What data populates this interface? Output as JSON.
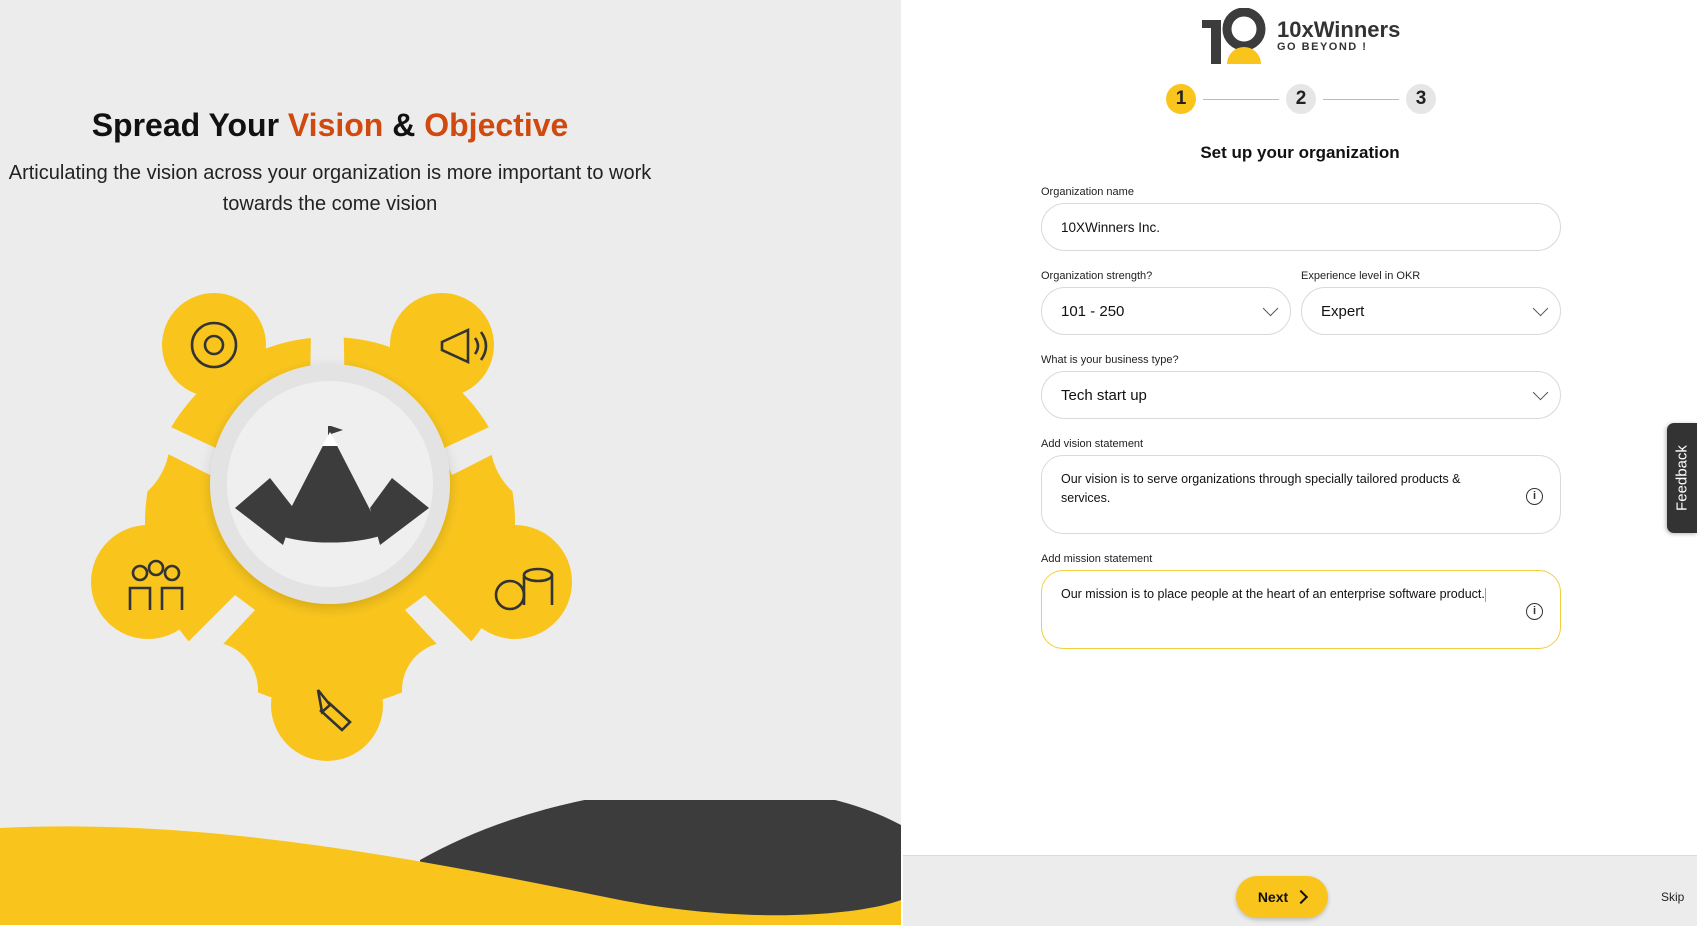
{
  "hero": {
    "title_part1": "Spread Your ",
    "title_accent1": "Vision",
    "title_part2": " & ",
    "title_accent2": "Objective",
    "subtitle": "Articulating the vision across your organization is more important to work towards the come vision"
  },
  "brand": {
    "name": "10xWinners",
    "tagline": "GO BEYOND !",
    "accent_color": "#f9c51d",
    "dark_color": "#3c3c3c",
    "highlight_color": "#d04a10"
  },
  "steps": [
    "1",
    "2",
    "3"
  ],
  "form": {
    "heading": "Set up your organization",
    "org_name_label": "Organization name",
    "org_name_value": "10XWinners Inc.",
    "strength_label": "Organization strength?",
    "strength_value": "101 - 250",
    "experience_label": "Experience level in OKR",
    "experience_value": "Expert",
    "business_label": "What is your business type?",
    "business_value": "Tech start up",
    "vision_label": "Add vision statement",
    "vision_value": "Our vision is to serve organizations through specially tailored products & services.",
    "mission_label": "Add mission statement",
    "mission_value": "Our mission is to place people at the heart of an enterprise software product."
  },
  "footer": {
    "next_label": "Next",
    "skip_label": "Skip"
  },
  "feedback_label": "Feedback"
}
